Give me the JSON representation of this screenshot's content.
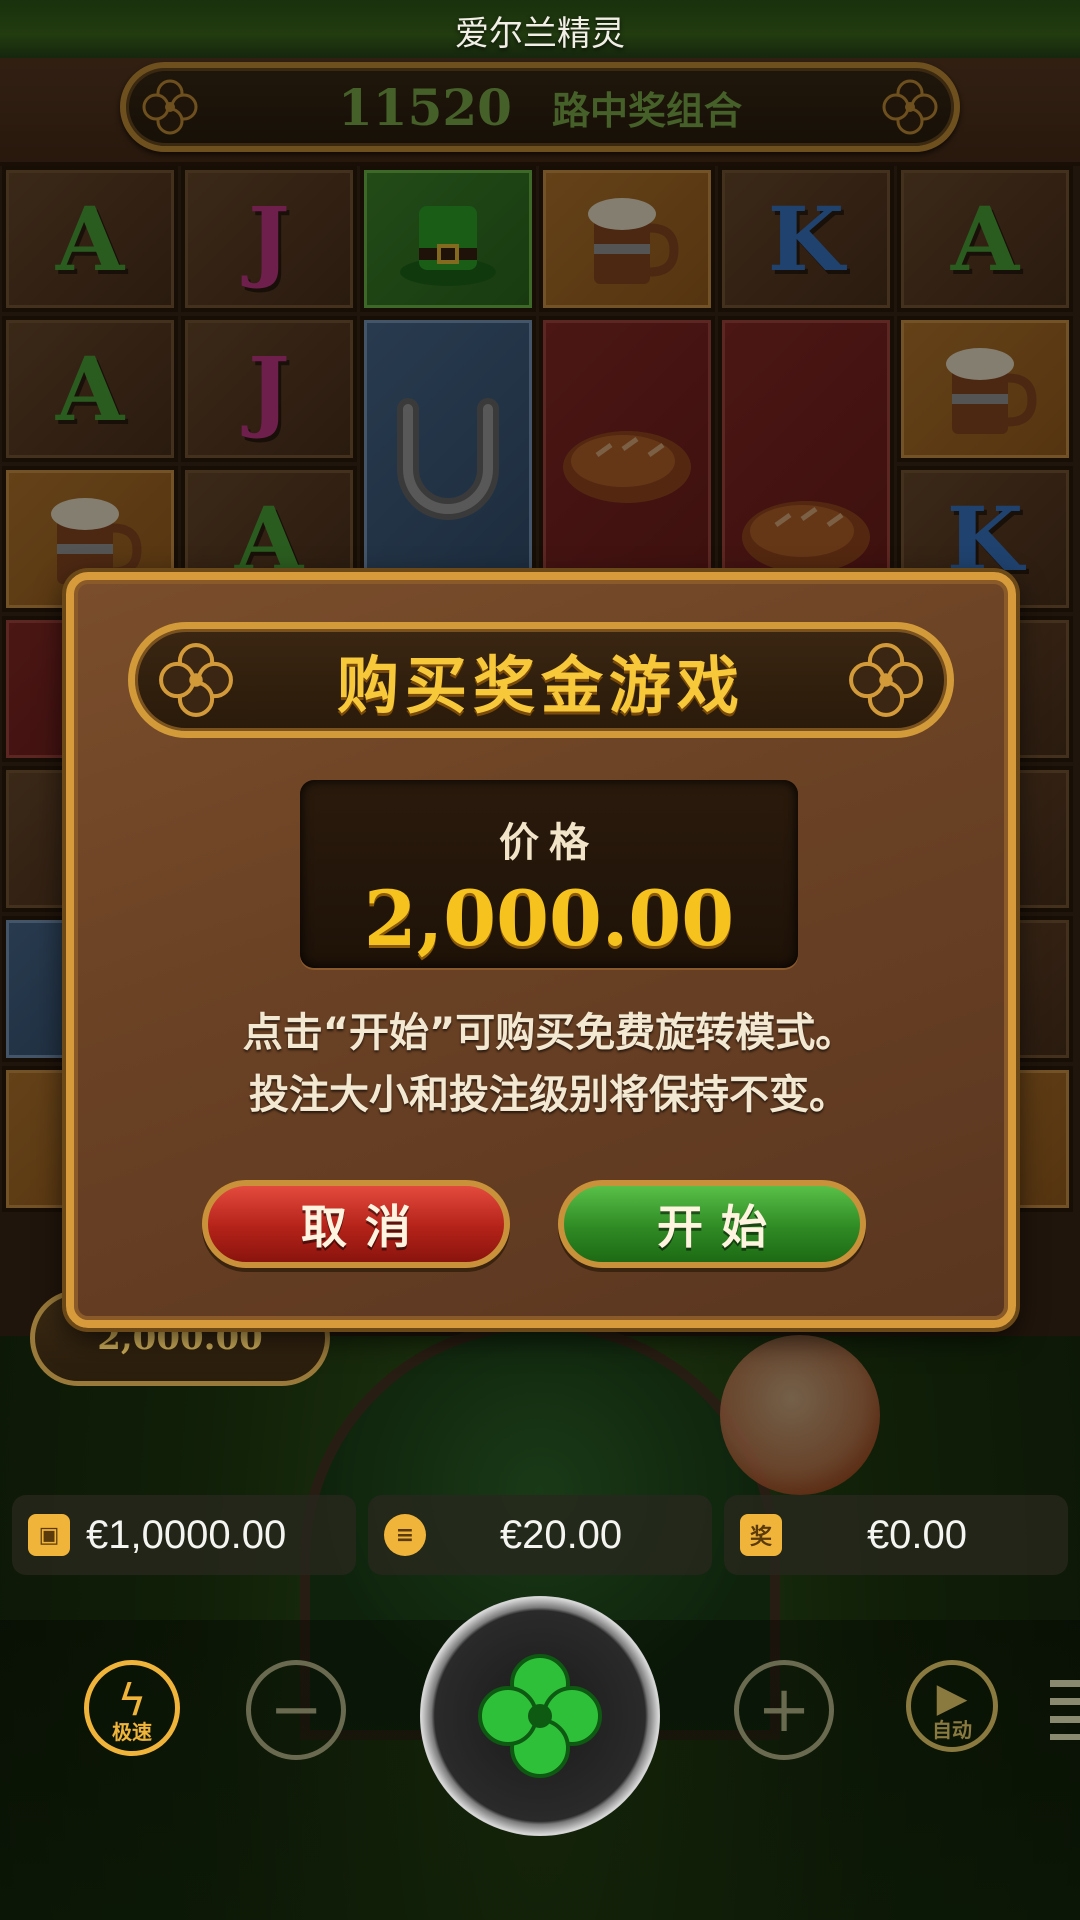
{
  "app": {
    "title": "爱尔兰精灵"
  },
  "ways": {
    "count": "11520",
    "label": "路中奖组合"
  },
  "reels": {
    "rows": [
      [
        "A",
        "J",
        "hat-icon",
        "mug-icon",
        "K",
        "A"
      ],
      [
        "A",
        "J",
        "horseshoe-icon",
        "bread-icon",
        "bread-icon",
        "mug-icon"
      ],
      [
        "mug-icon",
        "A",
        "horseshoe-icon",
        "bread-icon",
        "bread-icon",
        "K"
      ]
    ]
  },
  "win_pill": {
    "value": "2,000.00"
  },
  "modal": {
    "title": "购买奖金游戏",
    "price_label": "价格",
    "price_value": "2,000.00",
    "desc_line1": "点击“开始”可购买免费旋转模式。",
    "desc_line2": "投注大小和投注级别将保持不变。",
    "cancel_label": "取消",
    "start_label": "开始"
  },
  "balance": {
    "wallet": "€1,0000.00",
    "bet": "€20.00",
    "win": "€0.00",
    "win_icon_text": "奖"
  },
  "controls": {
    "turbo_label": "极速",
    "auto_label": "自动"
  },
  "colors": {
    "accent_gold": "#f6c21e",
    "cancel_red": "#b32218",
    "start_green": "#2f8a24"
  }
}
